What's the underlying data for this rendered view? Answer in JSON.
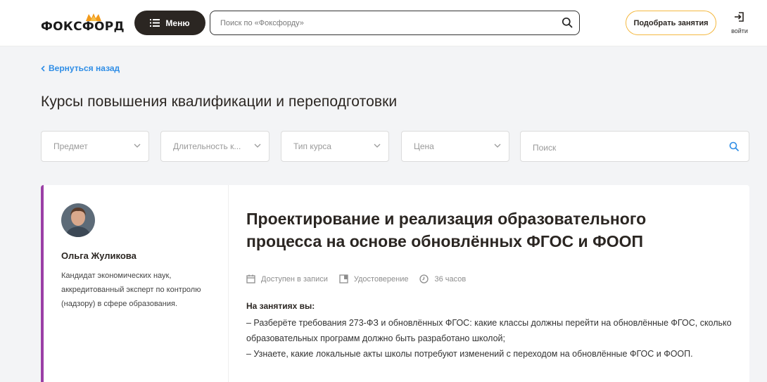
{
  "header": {
    "logo_text": "ФОКСФОРД",
    "menu_label": "Меню",
    "search_placeholder": "Поиск по «Фоксфорду»",
    "pick_label": "Подобрать занятия",
    "login_label": "войти"
  },
  "page": {
    "back_label": "Вернуться назад",
    "title": "Курсы повышения квалификации и переподготовки"
  },
  "filters": {
    "items": [
      {
        "label": "Предмет"
      },
      {
        "label": "Длительность к..."
      },
      {
        "label": "Тип курса"
      },
      {
        "label": "Цена"
      }
    ],
    "search_placeholder": "Поиск"
  },
  "card": {
    "accent": "#9b3fa6",
    "author": {
      "name": "Ольга Жуликова",
      "bio": "Кандидат экономических наук, аккредитованный эксперт по контролю (надзору) в сфере образования."
    },
    "title": "Проектирование и реализация образовательного процесса на основе обновлённых ФГОС и ФООП",
    "meta": [
      {
        "icon": "calendar-icon",
        "label": "Доступен в записи"
      },
      {
        "icon": "certificate-icon",
        "label": "Удостоверение"
      },
      {
        "icon": "clock-icon",
        "label": "36 часов"
      }
    ],
    "desc_heading": "На занятиях вы:",
    "desc_lines": [
      "– Разберёте требования 273-ФЗ и обновлённых ФГОС: какие классы должны перейти на обновлённые ФГОС, сколько образовательных программ должно быть разработано школой;",
      "– Узнаете, какие локальные акты школы потребуют изменений с переходом на обновлённые ФГОС и ФООП."
    ]
  }
}
